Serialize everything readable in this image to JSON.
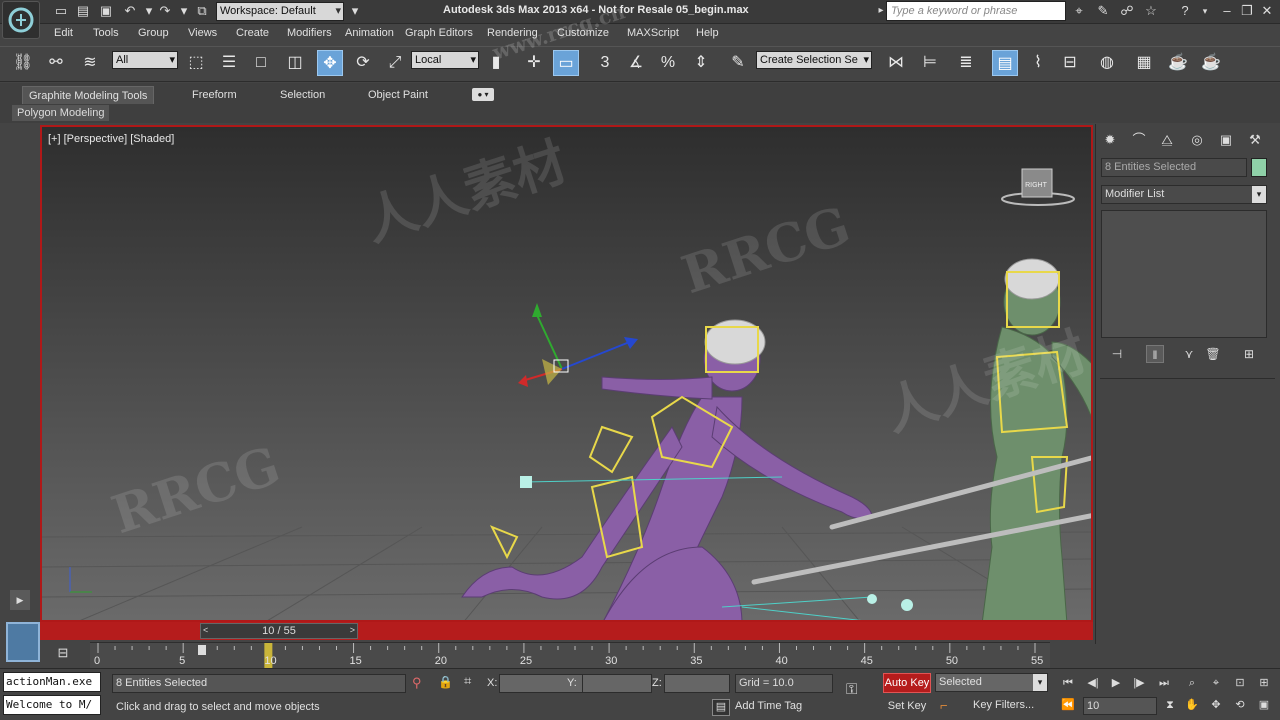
{
  "titlebar": {
    "workspace": "Workspace: Default",
    "window_title": "Autodesk 3ds Max  2013 x64  - Not for Resale   05_begin.max",
    "search_placeholder": "Type a keyword or phrase"
  },
  "menu": [
    "Edit",
    "Tools",
    "Group",
    "Views",
    "Create",
    "Modifiers",
    "Animation",
    "Graph Editors",
    "Rendering",
    "Customize",
    "MAXScript",
    "Help"
  ],
  "toolbar": {
    "selection_filter": "All",
    "ref_coord": "Local",
    "named_selection": "Create Selection Se",
    "snap_labels": [
      "3",
      "%"
    ]
  },
  "ribbon": {
    "tabs": [
      "Graphite Modeling Tools",
      "Freeform",
      "Selection",
      "Object Paint"
    ],
    "active_tab": "Graphite Modeling Tools",
    "sub_panel": "Polygon Modeling"
  },
  "viewport": {
    "label": "[+] [Perspective] [Shaded]",
    "viewcube_label": "RIGHT",
    "accent_color": "#b01818"
  },
  "timeline": {
    "frame_display": "10 / 55",
    "prev": "<",
    "next": ">",
    "current_frame": 10,
    "total_frames": 55,
    "ticks": [
      "0",
      "5",
      "10",
      "15",
      "20",
      "25",
      "30",
      "35",
      "40",
      "45",
      "50",
      "55"
    ]
  },
  "command_panel": {
    "selection_name": "8 Entities Selected",
    "selection_color": "#8fd1a8",
    "modifier_list": "Modifier List"
  },
  "status": {
    "listener_top": "actionMan.exe",
    "listener_bottom": "Welcome to M/",
    "selection_count": "8 Entities Selected",
    "prompt": "Click and drag to select and move objects",
    "x_label": "X:",
    "y_label": "Y:",
    "z_label": "Z:",
    "grid": "Grid = 10.0",
    "add_time_tag": "Add Time Tag",
    "auto_key": "Auto Key",
    "set_key": "Set Key",
    "key_mode": "Selected",
    "key_filters": "Key Filters...",
    "frame_field": "10"
  },
  "watermarks": [
    "RRCG",
    "人人素材",
    "www.rrcg.cn",
    "人人素材"
  ]
}
